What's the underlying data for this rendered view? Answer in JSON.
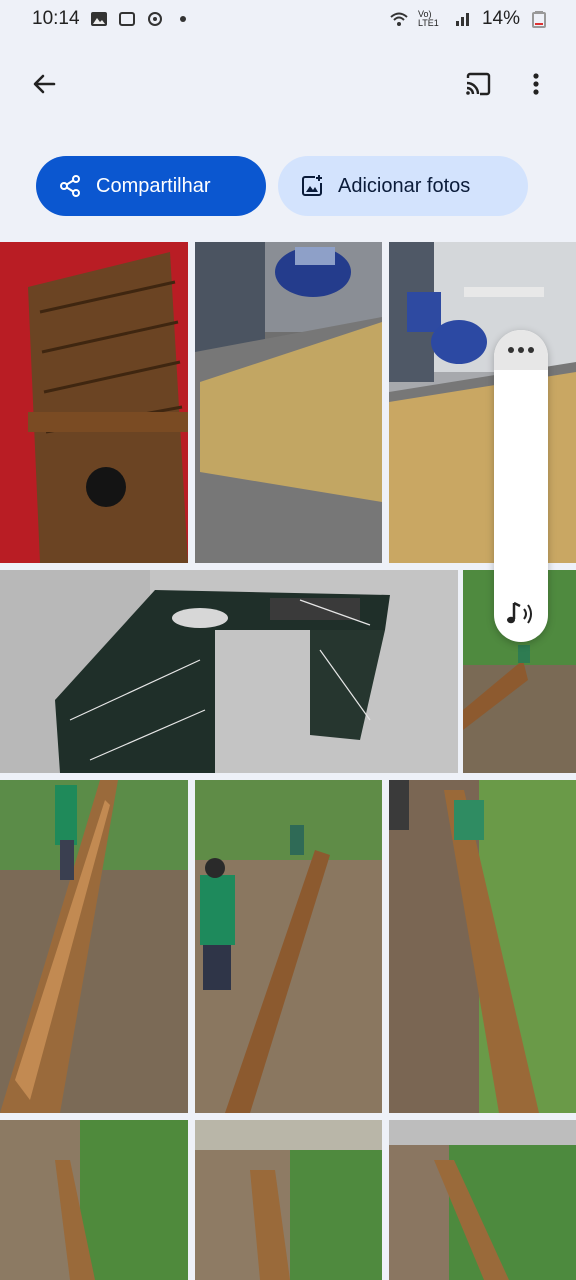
{
  "status": {
    "time": "10:14",
    "battery": "14%",
    "network": "Vo) LTE1"
  },
  "toolbar": {
    "share_label": "Compartilhar",
    "add_label": "Adicionar fotos"
  },
  "colors": {
    "accent": "#0b57d0",
    "accent_light": "#d3e3fd",
    "background": "#eef1f8"
  },
  "icons": [
    "back-arrow-icon",
    "cast-icon",
    "more-vert-icon",
    "share-icon",
    "add-photo-icon",
    "more-horiz-icon",
    "audio-icon"
  ]
}
